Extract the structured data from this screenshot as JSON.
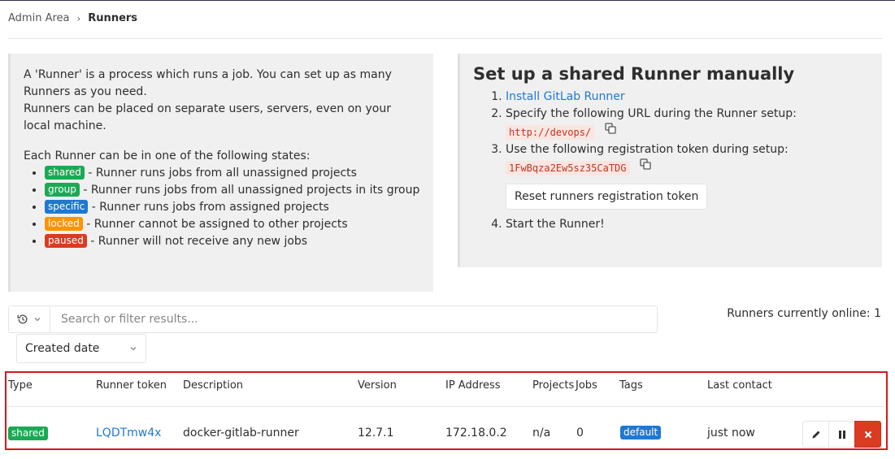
{
  "breadcrumb": {
    "parent": "Admin Area",
    "current": "Runners"
  },
  "info": {
    "intro": "A 'Runner' is a process which runs a job. You can set up as many Runners as you need.",
    "placement": "Runners can be placed on separate users, servers, even on your local machine.",
    "states_title": "Each Runner can be in one of the following states:",
    "states": [
      {
        "badge": "shared",
        "desc": "- Runner runs jobs from all unassigned projects"
      },
      {
        "badge": "group",
        "desc": "- Runner runs jobs from all unassigned projects in its group"
      },
      {
        "badge": "specific",
        "desc": "- Runner runs jobs from assigned projects"
      },
      {
        "badge": "locked",
        "desc": "- Runner cannot be assigned to other projects"
      },
      {
        "badge": "paused",
        "desc": "- Runner will not receive any new jobs"
      }
    ]
  },
  "setup": {
    "title": "Set up a shared Runner manually",
    "step1_link": "Install GitLab Runner",
    "step2_text": "Specify the following URL during the Runner setup:",
    "url": "http://devops/",
    "step3_text": "Use the following registration token during setup:",
    "token": "1FwBqza2Ew5sz35CaTDG",
    "reset_button": "Reset runners registration token",
    "step4_text": "Start the Runner!"
  },
  "filter": {
    "placeholder": "Search or filter results..."
  },
  "online": "Runners currently online: 1",
  "sort": {
    "selected": "Created date"
  },
  "table": {
    "headers": [
      "Type",
      "Runner token",
      "Description",
      "Version",
      "IP Address",
      "Projects",
      "Jobs",
      "Tags",
      "Last contact"
    ],
    "row": {
      "type": "shared",
      "token": "LQDTmw4x",
      "description": "docker-gitlab-runner",
      "version": "12.7.1",
      "ip": "172.18.0.2",
      "projects": "n/a",
      "jobs": "0",
      "tag": "default",
      "last_contact": "just now"
    }
  },
  "colors": {
    "success": "#1aaa55",
    "info": "#1f78d1",
    "warning": "#fc9403",
    "danger": "#db3b21",
    "highlight_border": "#d9151b"
  },
  "icons": {
    "history": "history-icon",
    "chevron": "chevron-down-icon",
    "copy": "copy-icon",
    "edit": "pencil-icon",
    "pause": "pause-icon",
    "remove": "close-icon"
  }
}
